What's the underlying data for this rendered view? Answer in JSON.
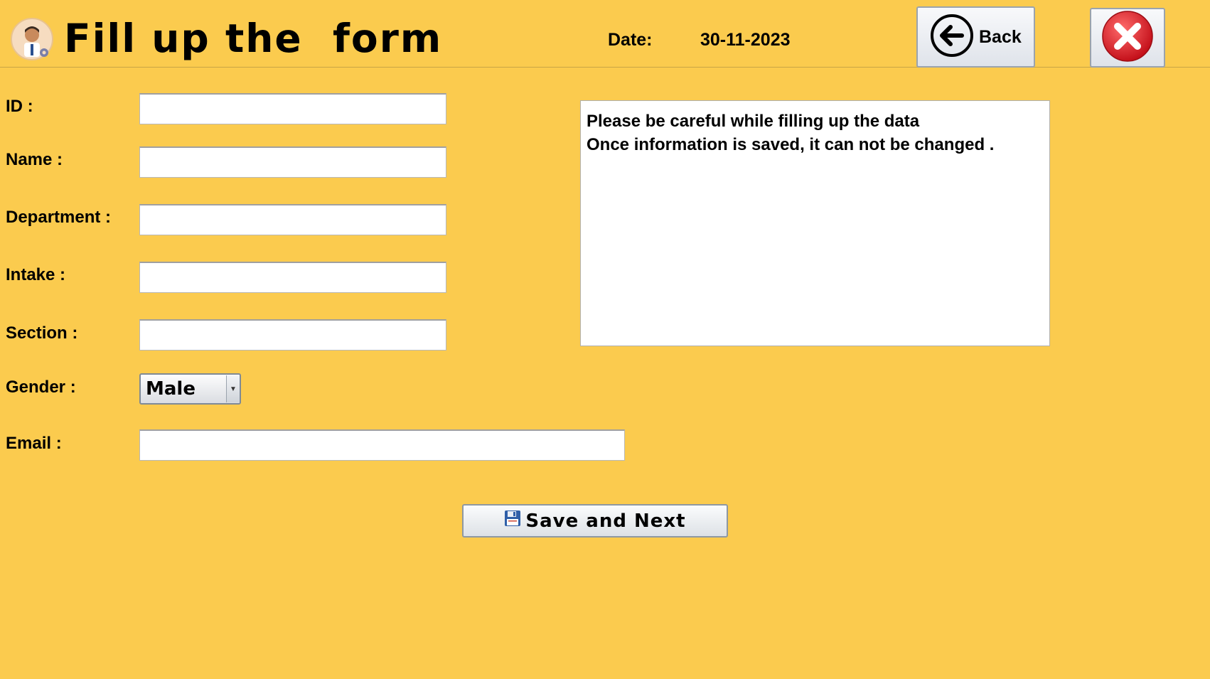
{
  "header": {
    "title": "Fill up the  form",
    "date_label": "Date:",
    "date_value": "30-11-2023",
    "back_label": "Back",
    "avatar_icon": "user-avatar-icon",
    "close_icon": "close-icon"
  },
  "form": {
    "id_label": "ID :",
    "name_label": "Name :",
    "department_label": "Department :",
    "intake_label": "Intake :",
    "section_label": "Section :",
    "gender_label": "Gender :",
    "email_label": "Email :",
    "id_value": "",
    "name_value": "",
    "department_value": "",
    "intake_value": "",
    "section_value": "",
    "email_value": "",
    "gender_selected": "Male"
  },
  "notice": {
    "line1": "Please be careful while filling up the data",
    "line2": "Once information is saved, it can not be changed ."
  },
  "actions": {
    "save_label": "Save and Next",
    "save_icon": "floppy-disk-icon"
  },
  "colors": {
    "background": "#FBCB4E",
    "close_red": "#E8202A"
  }
}
